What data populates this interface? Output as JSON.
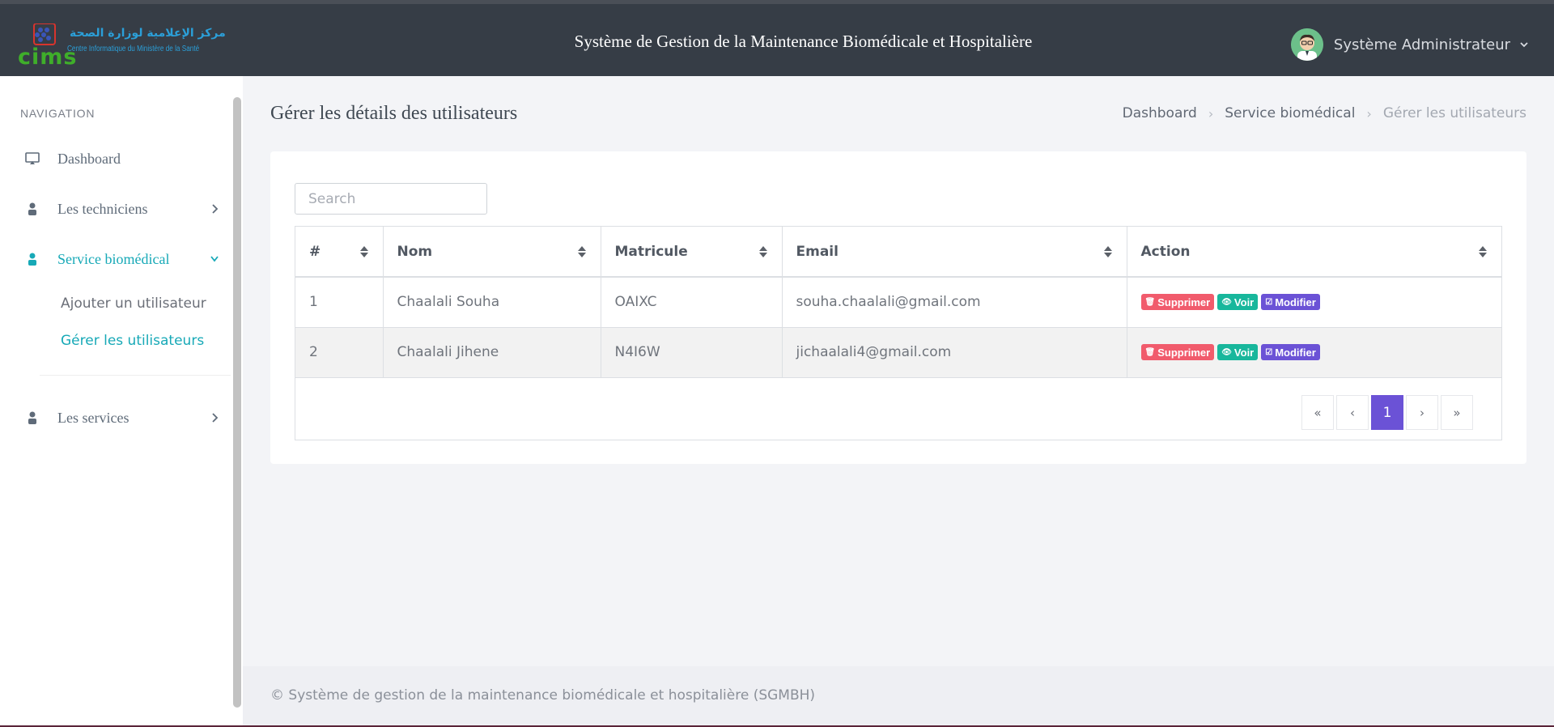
{
  "header": {
    "logo_arabic": "مركز الإعلامية لوزارة الصحة",
    "logo_cims": "cims",
    "logo_french": "Centre Informatique du Ministère de la Santé",
    "app_title": "Système de Gestion de la Maintenance Biomédicale et Hospitalière",
    "user_name": "Système Administrateur"
  },
  "sidebar": {
    "section_label": "NAVIGATION",
    "items": [
      {
        "label": "Dashboard",
        "icon": "monitor-icon"
      },
      {
        "label": "Les techniciens",
        "icon": "person-icon"
      },
      {
        "label": "Service biomédical",
        "icon": "person-icon",
        "active": true
      },
      {
        "label": "Les services",
        "icon": "person-icon"
      }
    ],
    "sub_items": [
      {
        "label": "Ajouter un utilisateur"
      },
      {
        "label": "Gérer les utilisateurs",
        "active": true
      }
    ]
  },
  "page": {
    "title": "Gérer les détails des utilisateurs",
    "breadcrumb": [
      "Dashboard",
      "Service biomédical",
      "Gérer les utilisateurs"
    ]
  },
  "search": {
    "placeholder": "Search",
    "value": ""
  },
  "table": {
    "columns": [
      "#",
      "Nom",
      "Matricule",
      "Email",
      "Action"
    ],
    "rows": [
      {
        "num": "1",
        "nom": "Chaalali Souha",
        "matricule": "OAIXC",
        "email": "souha.chaalali@gmail.com"
      },
      {
        "num": "2",
        "nom": "Chaalali Jihene",
        "matricule": "N4I6W",
        "email": "jichaalali4@gmail.com"
      }
    ],
    "actions": {
      "delete": "Supprimer",
      "view": "Voir",
      "edit": "Modifier"
    }
  },
  "pagination": {
    "first": "«",
    "prev": "‹",
    "current": "1",
    "next": "›",
    "last": "»"
  },
  "footer": {
    "text": "© Système de gestion de la maintenance biomédicale et hospitalière (SGMBH)"
  },
  "colors": {
    "header_bg": "#363d46",
    "accent_teal": "#17a9b7",
    "purple": "#6b52d6",
    "danger": "#f15b6c",
    "success": "#18b79c"
  }
}
